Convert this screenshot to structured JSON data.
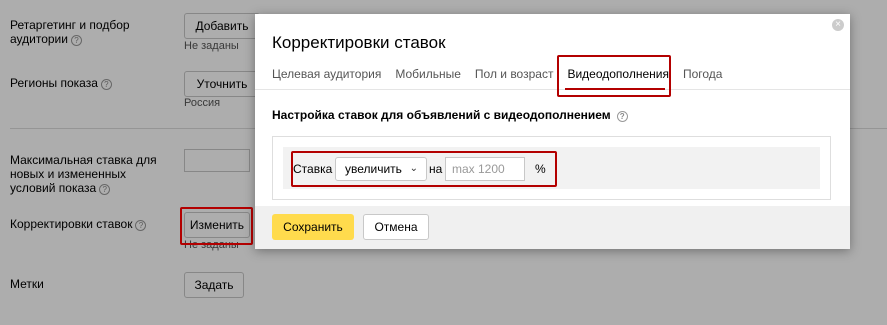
{
  "form": {
    "retargeting_label": "Ретаргетинг и подбор аудитории",
    "retargeting_button": "Добавить",
    "retargeting_note": "Не заданы",
    "regions_label": "Регионы показа",
    "regions_button": "Уточнить",
    "regions_note": "Россия",
    "maxbid_label": "Максимальная ставка для новых и измененных условий показа",
    "adjustments_label": "Корректировки ставок",
    "adjustments_button": "Изменить",
    "adjustments_note": "Не заданы",
    "tags_label": "Метки",
    "tags_button": "Задать",
    "help_icon": "?"
  },
  "modal": {
    "title": "Корректировки ставок",
    "tabs": [
      {
        "label": "Целевая аудитория"
      },
      {
        "label": "Мобильные"
      },
      {
        "label": "Пол и возраст"
      },
      {
        "label": "Видеодополнения",
        "active": true
      },
      {
        "label": "Погода"
      }
    ],
    "section_title": "Настройка ставок для объявлений с видеодополнением",
    "rate_label": "Ставка",
    "direction_value": "увеличить",
    "by_label": "на",
    "amount_placeholder": "max 1200",
    "unit": "%",
    "save_label": "Сохранить",
    "cancel_label": "Отмена",
    "close_symbol": "×"
  },
  "colors": {
    "accent": "#ffdb4d",
    "highlight": "#b30000",
    "overlay": "rgba(0,0,0,0.32)"
  }
}
